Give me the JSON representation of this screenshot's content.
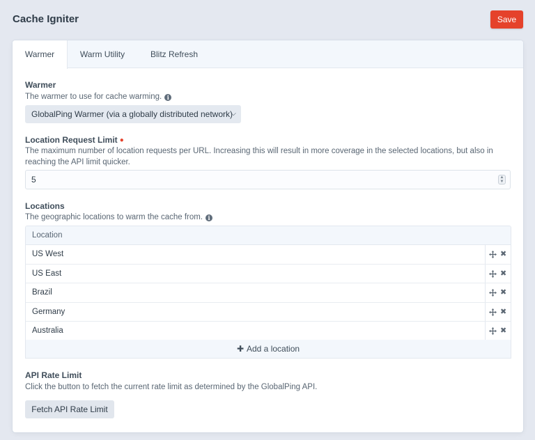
{
  "header": {
    "title": "Cache Igniter",
    "save_label": "Save"
  },
  "tabs": [
    {
      "label": "Warmer",
      "active": true
    },
    {
      "label": "Warm Utility",
      "active": false
    },
    {
      "label": "Blitz Refresh",
      "active": false
    }
  ],
  "warmer": {
    "label": "Warmer",
    "instructions": "The warmer to use for cache warming.",
    "selected": "GlobalPing Warmer (via a globally distributed network)"
  },
  "location_limit": {
    "label": "Location Request Limit",
    "instructions_line1": "The maximum number of location requests per URL. Increasing this will result in more coverage in the selected locations, but also in",
    "instructions_line2": "reaching the API limit quicker.",
    "value": "5"
  },
  "locations": {
    "label": "Locations",
    "instructions": "The geographic locations to warm the cache from.",
    "column_header": "Location",
    "rows": [
      "US West",
      "US East",
      "Brazil",
      "Germany",
      "Australia"
    ],
    "add_label": "Add a location"
  },
  "rate_limit": {
    "label": "API Rate Limit",
    "instructions": "Click the button to fetch the current rate limit as determined by the GlobalPing API.",
    "button_label": "Fetch API Rate Limit"
  },
  "colors": {
    "accent": "#e5422b",
    "background": "#e4e8f0",
    "panel": "#ffffff"
  },
  "icons": {
    "info": "info-icon",
    "chevron": "chevron-down-icon",
    "move": "move-icon",
    "delete": "delete-icon",
    "add": "plus-icon"
  }
}
